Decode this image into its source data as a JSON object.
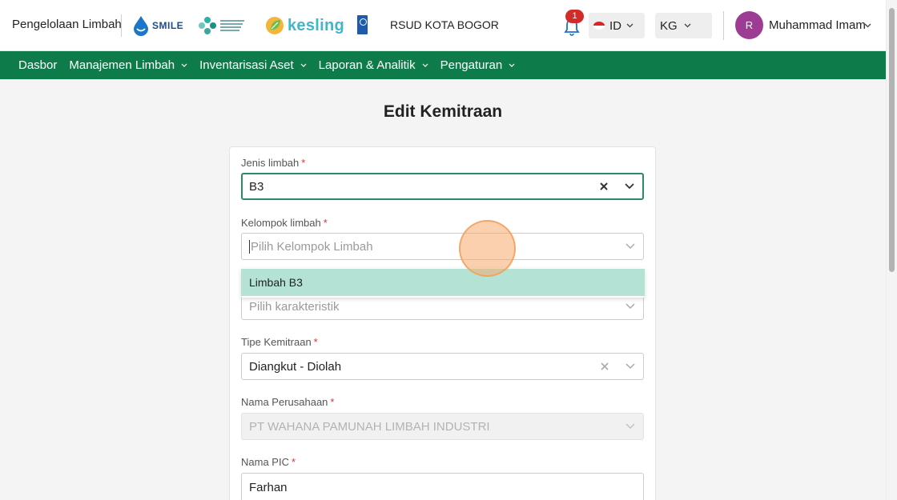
{
  "header": {
    "app_title": "Pengelolaan Limbah",
    "logos": {
      "smile_text": "SMILE",
      "kesling_text": "kesling"
    },
    "hospital": "RSUD KOTA BOGOR",
    "notifications_count": "1",
    "language": "ID",
    "unit": "KG",
    "avatar_initial": "R",
    "username": "Muhammad Imam"
  },
  "nav": {
    "items": [
      {
        "label": "Dasbor"
      },
      {
        "label": "Manajemen Limbah"
      },
      {
        "label": "Inventarisasi Aset"
      },
      {
        "label": "Laporan & Analitik"
      },
      {
        "label": "Pengaturan"
      }
    ]
  },
  "page": {
    "title": "Edit Kemitraan"
  },
  "form": {
    "jenis_limbah": {
      "label": "Jenis limbah",
      "value": "B3"
    },
    "kelompok_limbah": {
      "label": "Kelompok limbah",
      "placeholder": "Pilih Kelompok Limbah"
    },
    "karakteristik": {
      "placeholder": "Pilih karakteristik"
    },
    "tipe_kemitraan": {
      "label": "Tipe Kemitraan",
      "value": "Diangkut - Diolah"
    },
    "nama_perusahaan": {
      "label": "Nama Perusahaan",
      "value": "PT WAHANA PAMUNAH LIMBAH INDUSTRI"
    },
    "nama_pic": {
      "label": "Nama PIC",
      "value": "Farhan"
    },
    "required_mark": "*"
  },
  "dropdown": {
    "options": [
      {
        "label": "Limbah B3"
      }
    ]
  },
  "colors": {
    "nav_bg": "#0e7c4a",
    "focus_border": "#2a8c67",
    "option_highlight": "#b4e3d5",
    "badge": "#d32a2a",
    "avatar": "#9c3d93"
  }
}
